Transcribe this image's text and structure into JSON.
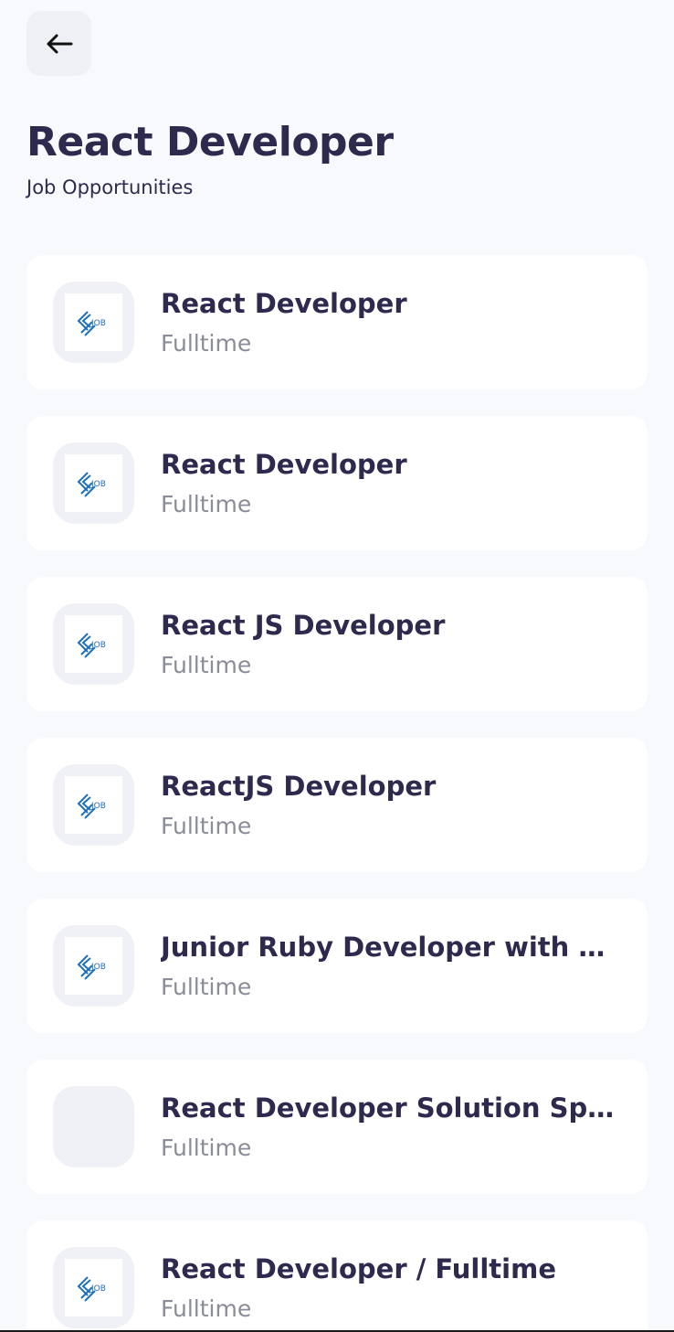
{
  "header": {
    "back_icon": "arrow-left-icon",
    "title": "React Developer",
    "subtitle": "Job Opportunities"
  },
  "logo": {
    "text": "JOB",
    "accent_color": "#1f6fbf"
  },
  "jobs": [
    {
      "title": "React Developer",
      "type": "Fulltime",
      "has_logo": true
    },
    {
      "title": "React Developer",
      "type": "Fulltime",
      "has_logo": true
    },
    {
      "title": "React JS Developer",
      "type": "Fulltime",
      "has_logo": true
    },
    {
      "title": "ReactJS Developer",
      "type": "Fulltime",
      "has_logo": true
    },
    {
      "title": "Junior Ruby Developer with R...",
      "type": "Fulltime",
      "has_logo": true
    },
    {
      "title": "React Developer Solution Spe...",
      "type": "Fulltime",
      "has_logo": false
    },
    {
      "title": "React Developer / Fulltime",
      "type": "Fulltime",
      "has_logo": true
    }
  ]
}
